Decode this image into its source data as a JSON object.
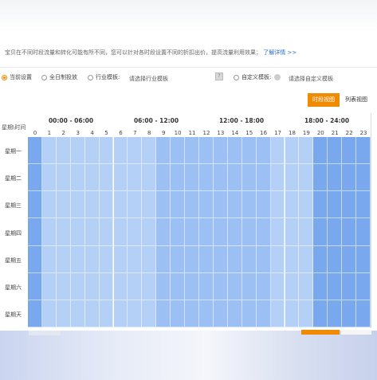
{
  "info": {
    "text": "宝贝在不同时段流量和转化可能有所不同，您可以针对各时段设置不同的折扣出价，提高流量利用效果；",
    "link": "了解详情 >>"
  },
  "options": {
    "current": "当前设置",
    "allday": "全日制投放",
    "industry": "行业模板:",
    "industry_select": "请选择行业模板",
    "custom": "自定义模板:",
    "custom_select": "请选择自定义模板"
  },
  "buttons": {
    "schedule": "时段视图",
    "list": "列表视图"
  },
  "schedule": {
    "corner": "星期\\时间",
    "ranges": [
      "00:00 - 06:00",
      "06:00 - 12:00",
      "12:00 - 18:00",
      "18:00 - 24:00"
    ],
    "hours": [
      "0",
      "1",
      "2",
      "3",
      "4",
      "5",
      "6",
      "7",
      "8",
      "9",
      "10",
      "11",
      "12",
      "13",
      "14",
      "15",
      "16",
      "17",
      "18",
      "19",
      "20",
      "21",
      "22",
      "23"
    ],
    "days": [
      "星期一",
      "星期二",
      "星期三",
      "星期四",
      "星期五",
      "星期六",
      "星期天"
    ]
  },
  "colors": {
    "accent": "#f08a00",
    "cell_light": "#b4d0f7",
    "cell_mid": "#9cc0f3",
    "cell_dark": "#7aa8ee",
    "link": "#2a6ec5"
  }
}
